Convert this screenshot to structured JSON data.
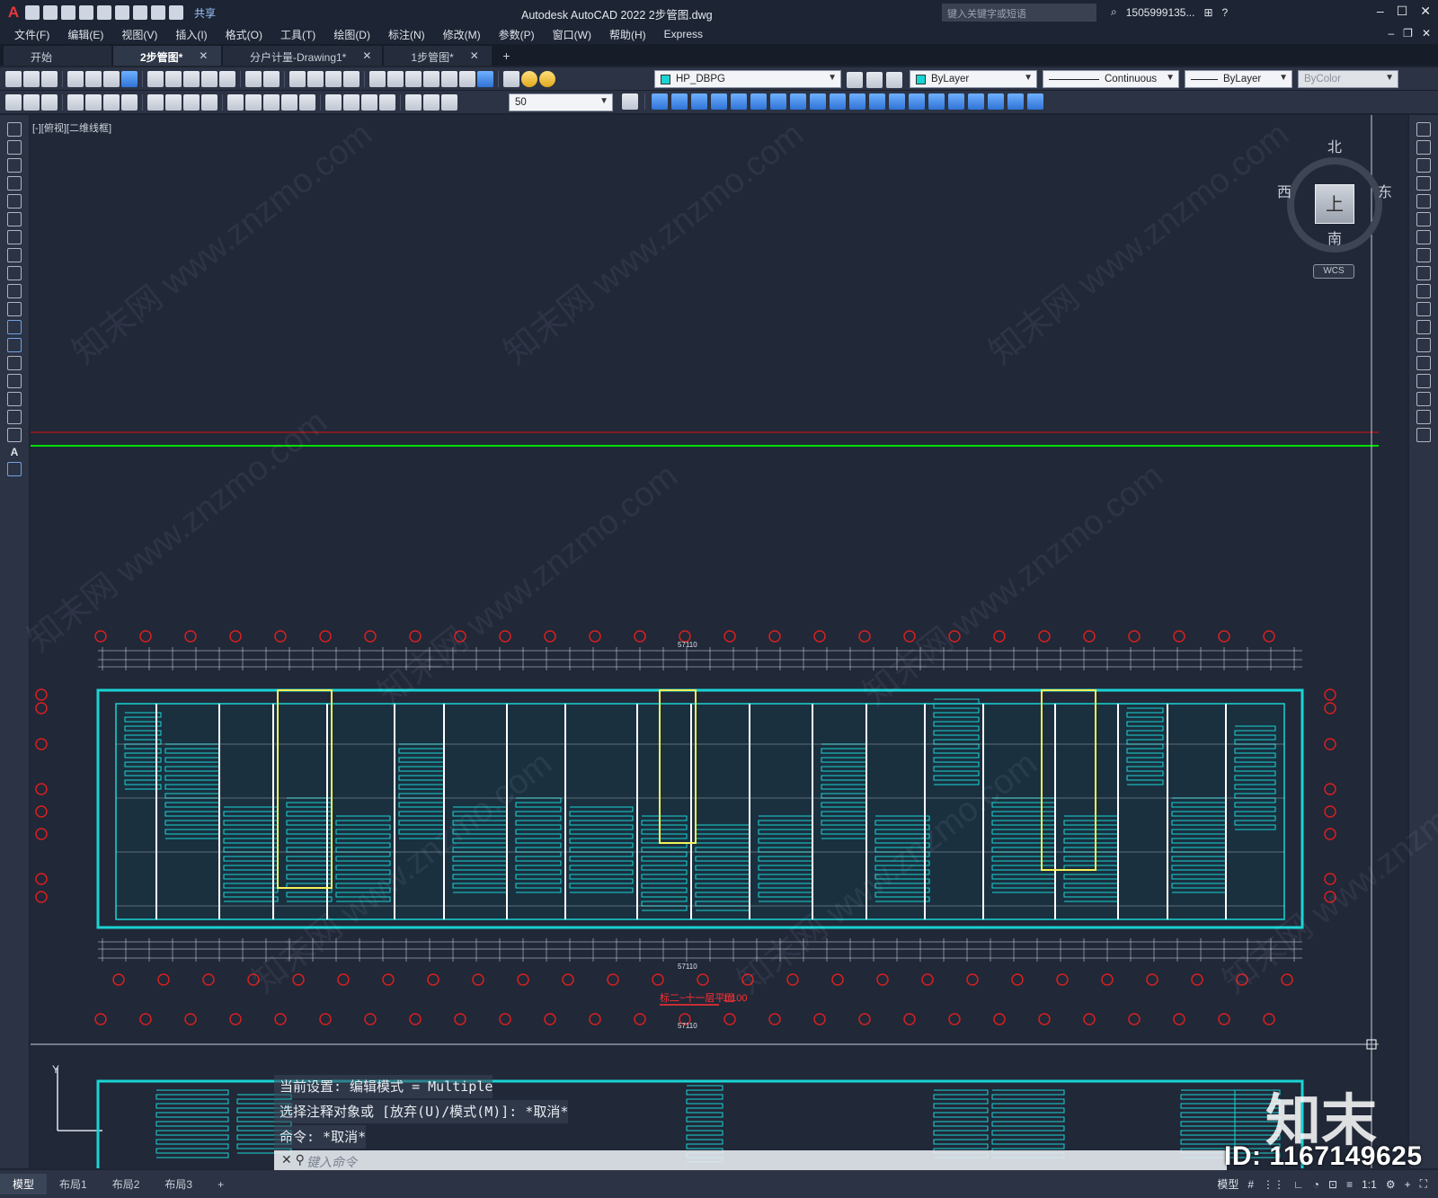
{
  "window": {
    "title": "Autodesk AutoCAD 2022    2步管图.dwg",
    "search_placeholder": "键入关键字或短语",
    "user": "1505999135...",
    "share_label": "共享"
  },
  "menu": [
    "文件(F)",
    "编辑(E)",
    "视图(V)",
    "插入(I)",
    "格式(O)",
    "工具(T)",
    "绘图(D)",
    "标注(N)",
    "修改(M)",
    "参数(P)",
    "窗口(W)",
    "帮助(H)",
    "Express"
  ],
  "tabs": [
    {
      "label": "开始"
    },
    {
      "label": "2步管图*"
    },
    {
      "label": "分户计量-Drawing1*"
    },
    {
      "label": "1步管图*"
    }
  ],
  "toolbar": {
    "layer": "HP_DBPG",
    "color": "ByLayer",
    "linetype": "Continuous",
    "lineweight": "ByLayer",
    "plotstyle": "ByColor",
    "dimscale": "50"
  },
  "colors": {
    "layer_swatch": "#19d4d4",
    "color_swatch": "#19d4d4",
    "accent_green": "#00e000",
    "accent_red": "#e01010"
  },
  "viewport": {
    "label": "[-][俯视][二维线框]",
    "compass": {
      "n": "北",
      "s": "南",
      "w": "西",
      "e": "东",
      "face": "上",
      "wcs": "WCS"
    }
  },
  "drawing": {
    "title": "标二~十一层平面",
    "scale": "1:100",
    "total_dim": "57110"
  },
  "command": {
    "lines": [
      "当前设置: 编辑模式 = Multiple",
      "选择注释对象或 [放弃(U)/模式(M)]: *取消*",
      "命令: *取消*"
    ],
    "placeholder": "键入命令"
  },
  "layouts": [
    "模型",
    "布局1",
    "布局2",
    "布局3"
  ],
  "status": {
    "model": "模型",
    "scale": "1:1"
  },
  "watermark": {
    "text": "知末网 www.znzmo.com",
    "logo": "知末",
    "id": "ID: 1167149625"
  }
}
